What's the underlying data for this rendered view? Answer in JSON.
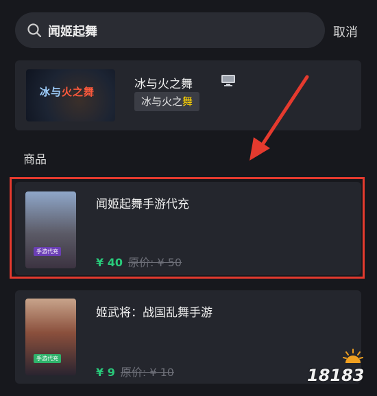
{
  "search": {
    "query": "闻姬起舞",
    "cancel_label": "取消"
  },
  "game": {
    "title": "冰与火之舞",
    "platform_icon": "monitor-icon",
    "tag_prefix": "冰与火之",
    "tag_highlight": "舞",
    "cover_logo_part1": "冰与",
    "cover_logo_part2": "火之舞"
  },
  "section_title": "商品",
  "products": [
    {
      "name": "闻姬起舞手游代充",
      "price": "¥ 40",
      "original_price": "原价: ¥ 50",
      "thumb_badge": "手游代充"
    },
    {
      "name": "姬武将：战国乱舞手游",
      "price": "¥ 9",
      "original_price": "原价: ¥ 10",
      "thumb_badge": "手游代充"
    }
  ],
  "watermark": "18183",
  "colors": {
    "highlight": "#e53a2e",
    "price": "#29c97a",
    "tag_highlight": "#ffd400"
  }
}
